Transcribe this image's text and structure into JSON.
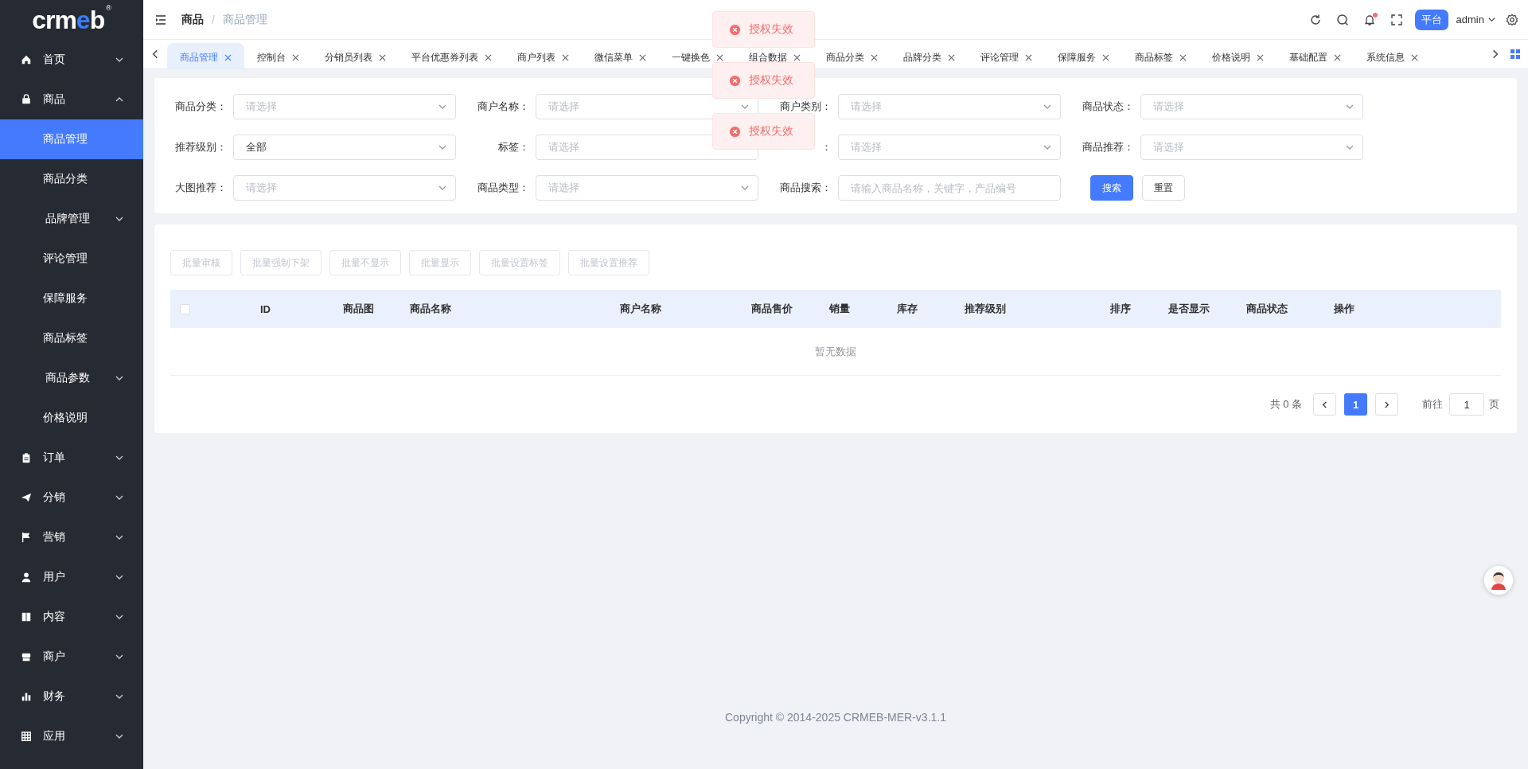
{
  "sidebar": {
    "logo": {
      "text": "crmeb",
      "mark": "®"
    },
    "items": [
      {
        "label": "首页",
        "expanded": false
      },
      {
        "label": "商品",
        "expanded": true,
        "children": [
          {
            "label": "商品管理",
            "kind": "link",
            "selected": true
          },
          {
            "label": "商品分类",
            "kind": "link",
            "selected": false
          },
          {
            "label": "品牌管理",
            "kind": "group",
            "selected": false,
            "expanded": false
          },
          {
            "label": "评论管理",
            "kind": "link",
            "selected": false
          },
          {
            "label": "保障服务",
            "kind": "link",
            "selected": false
          },
          {
            "label": "商品标签",
            "kind": "link",
            "selected": false
          },
          {
            "label": "商品参数",
            "kind": "group",
            "selected": false,
            "expanded": false
          },
          {
            "label": "价格说明",
            "kind": "link",
            "selected": false
          }
        ]
      },
      {
        "label": "订单",
        "expanded": false
      },
      {
        "label": "分销",
        "expanded": false
      },
      {
        "label": "营销",
        "expanded": false
      },
      {
        "label": "用户",
        "expanded": false
      },
      {
        "label": "内容",
        "expanded": false
      },
      {
        "label": "商户",
        "expanded": false
      },
      {
        "label": "财务",
        "expanded": false
      },
      {
        "label": "应用",
        "expanded": false
      }
    ]
  },
  "header": {
    "breadcrumb": [
      "商品",
      "商品管理"
    ],
    "breadcrumb_separator": "/",
    "notifications_unread": true,
    "role_badge": "平台",
    "user": "admin"
  },
  "tabs": [
    {
      "label": "商品管理",
      "selected": true
    },
    {
      "label": "控制台",
      "selected": false
    },
    {
      "label": "分销员列表",
      "selected": false
    },
    {
      "label": "平台优惠券列表",
      "selected": false
    },
    {
      "label": "商户列表",
      "selected": false
    },
    {
      "label": "微信菜单",
      "selected": false
    },
    {
      "label": "一键换色",
      "selected": false
    },
    {
      "label": "组合数据",
      "selected": false
    },
    {
      "label": "商品分类",
      "selected": false
    },
    {
      "label": "品牌分类",
      "selected": false
    },
    {
      "label": "评论管理",
      "selected": false
    },
    {
      "label": "保障服务",
      "selected": false
    },
    {
      "label": "商品标签",
      "selected": false
    },
    {
      "label": "价格说明",
      "selected": false
    },
    {
      "label": "基础配置",
      "selected": false
    },
    {
      "label": "系统信息",
      "selected": false
    }
  ],
  "filters": [
    {
      "label": "商品分类：",
      "kind": "select",
      "placeholder": "请选择"
    },
    {
      "label": "商户名称：",
      "kind": "select",
      "placeholder": "请选择"
    },
    {
      "label": "商户类别：",
      "kind": "select",
      "placeholder": "请选择"
    },
    {
      "label": "商品状态：",
      "kind": "select",
      "placeholder": "请选择"
    },
    {
      "label": "推荐级别：",
      "kind": "select",
      "value": "全部"
    },
    {
      "label": "标签：",
      "kind": "select",
      "placeholder": "请选择",
      "arrow": false
    },
    {
      "label": "：",
      "kind": "select",
      "placeholder": "请选择"
    },
    {
      "label": "商品推荐：",
      "kind": "select",
      "placeholder": "请选择"
    },
    {
      "label": "大图推荐：",
      "kind": "select",
      "placeholder": "请选择"
    },
    {
      "label": "商品类型：",
      "kind": "select",
      "placeholder": "请选择"
    },
    {
      "label": "商品搜索：",
      "kind": "input",
      "placeholder": "请输入商品名称，关键字，产品编号"
    }
  ],
  "filter_buttons": {
    "search": "搜索",
    "reset": "重置"
  },
  "batch_actions": [
    {
      "label": "批量审核",
      "disabled": true
    },
    {
      "label": "批量强制下架",
      "disabled": true
    },
    {
      "label": "批量不显示",
      "disabled": true
    },
    {
      "label": "批量显示",
      "disabled": true
    },
    {
      "label": "批量设置标签",
      "disabled": true
    },
    {
      "label": "批量设置推荐",
      "disabled": true
    }
  ],
  "table": {
    "select_all_checked": false,
    "columns": [
      "ID",
      "商品图",
      "商品名称",
      "商户名称",
      "商品售价",
      "销量",
      "库存",
      "推荐级别",
      "排序",
      "是否显示",
      "商品状态",
      "操作"
    ],
    "empty_text": "暂无数据"
  },
  "pagination": {
    "total": "共 0 条",
    "pages": [
      {
        "label": "1",
        "selected": true
      }
    ],
    "goto_label": "前往",
    "goto_value": "1",
    "page_suffix": "页"
  },
  "footer": "Copyright © 2014-2025 CRMEB-MER-v3.1.1",
  "toasts": [
    {
      "kind": "error",
      "message": "授权失效"
    },
    {
      "kind": "error",
      "message": "授权失效"
    },
    {
      "kind": "error",
      "message": "授权失效"
    }
  ]
}
